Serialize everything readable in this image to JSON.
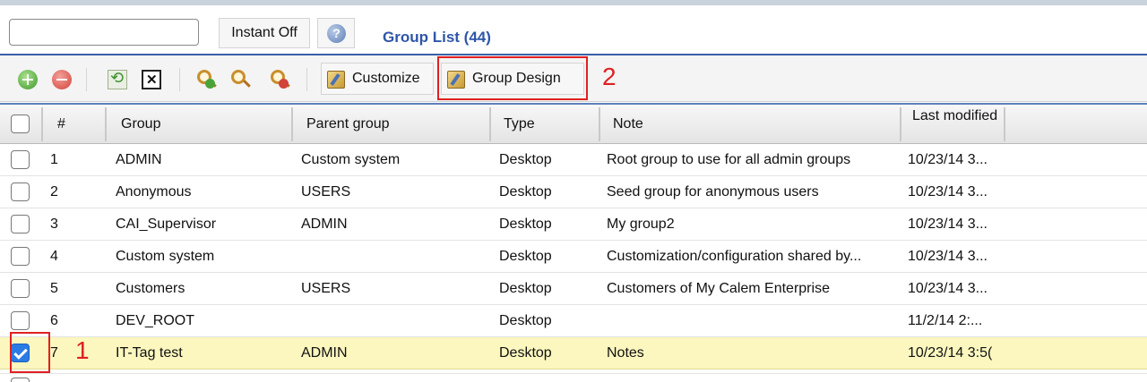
{
  "search": {
    "value": "",
    "placeholder": ""
  },
  "instant_label": "Instant Off",
  "list_title": "Group List (44)",
  "toolbar": {
    "customize_label": "Customize",
    "group_design_label": "Group Design"
  },
  "annotations": {
    "box1_number": "1",
    "box2_number": "2"
  },
  "columns": {
    "num": "#",
    "group": "Group",
    "parent": "Parent group",
    "type": "Type",
    "note": "Note",
    "modified": "Last modified"
  },
  "rows": [
    {
      "num": "1",
      "group": "ADMIN",
      "parent": "Custom system",
      "type": "Desktop",
      "note": "Root group to use for all admin groups",
      "modified": "10/23/14 3...",
      "checked": false
    },
    {
      "num": "2",
      "group": "Anonymous",
      "parent": "USERS",
      "type": "Desktop",
      "note": "Seed group for anonymous users",
      "modified": "10/23/14 3...",
      "checked": false
    },
    {
      "num": "3",
      "group": "CAI_Supervisor",
      "parent": "ADMIN",
      "type": "Desktop",
      "note": "My group2",
      "modified": "10/23/14 3...",
      "checked": false
    },
    {
      "num": "4",
      "group": "Custom system",
      "parent": "",
      "type": "Desktop",
      "note": "Customization/configuration shared by...",
      "modified": "10/23/14 3...",
      "checked": false
    },
    {
      "num": "5",
      "group": "Customers",
      "parent": "USERS",
      "type": "Desktop",
      "note": "Customers of My Calem Enterprise",
      "modified": "10/23/14 3...",
      "checked": false
    },
    {
      "num": "6",
      "group": "DEV_ROOT",
      "parent": "",
      "type": "Desktop",
      "note": "",
      "modified": "11/2/14 2:...",
      "checked": false
    },
    {
      "num": "7",
      "group": "IT-Tag test",
      "parent": "ADMIN",
      "type": "Desktop",
      "note": "Notes",
      "modified": "10/23/14 3:5(",
      "checked": true
    }
  ],
  "colors": {
    "accent": "#2e55a8",
    "selected_row": "#fbf7be",
    "highlight_box": "#e02020"
  }
}
